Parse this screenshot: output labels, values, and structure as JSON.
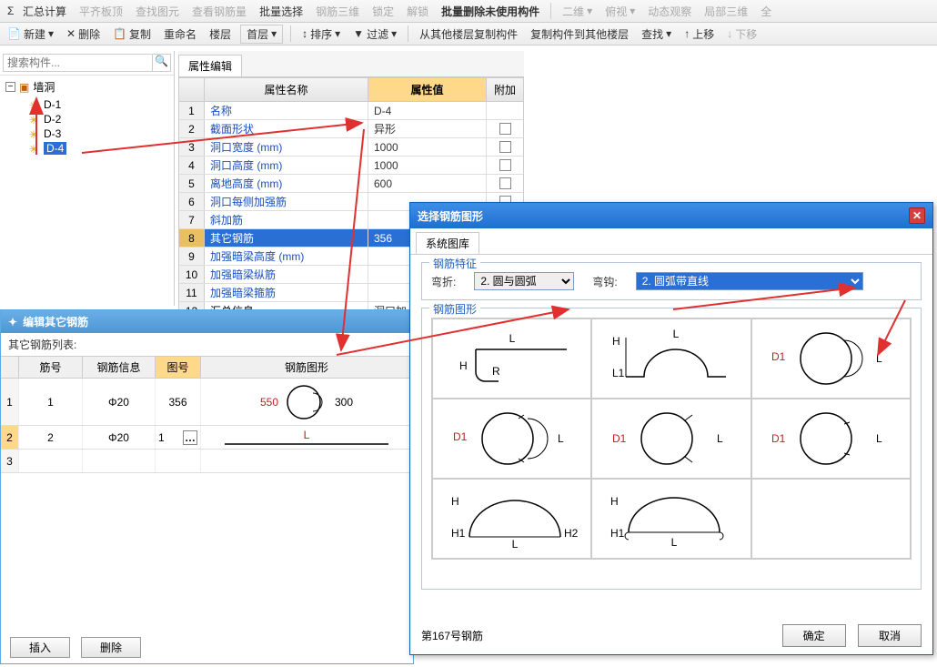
{
  "toolbar1": {
    "sum": "汇总计算",
    "flat": "平齐板顶",
    "find": "查找图元",
    "rebar": "查看钢筋量",
    "batchSel": "批量选择",
    "rebar3d": "钢筋三维",
    "lock": "锁定",
    "unlock": "解锁",
    "batchDel": "批量删除未使用构件",
    "two": "二维",
    "view": "俯视",
    "dyn": "动态观察",
    "part3d": "局部三维",
    "all": "全"
  },
  "toolbar2": {
    "new": "新建",
    "del": "删除",
    "copy": "复制",
    "rename": "重命名",
    "floor": "楼层",
    "first": "首层",
    "sort": "排序",
    "filter": "过滤",
    "copyFrom": "从其他楼层复制构件",
    "copyTo": "复制构件到其他楼层",
    "find": "查找",
    "up": "上移",
    "down": "下移"
  },
  "search": {
    "placeholder": "搜索构件..."
  },
  "tree": {
    "root": "墙洞",
    "items": [
      "D-1",
      "D-2",
      "D-3",
      "D-4"
    ]
  },
  "prop": {
    "tab": "属性编辑",
    "head": {
      "name": "属性名称",
      "value": "属性值",
      "extra": "附加"
    },
    "rows": [
      {
        "n": "1",
        "name": "名称",
        "val": "D-4",
        "link": true,
        "ck": false
      },
      {
        "n": "2",
        "name": "截面形状",
        "val": "异形",
        "link": true,
        "ck": true
      },
      {
        "n": "3",
        "name": "洞口宽度 (mm)",
        "val": "1000",
        "link": true,
        "ck": true
      },
      {
        "n": "4",
        "name": "洞口高度 (mm)",
        "val": "1000",
        "link": true,
        "ck": true
      },
      {
        "n": "5",
        "name": "离地高度 (mm)",
        "val": "600",
        "link": true,
        "ck": true
      },
      {
        "n": "6",
        "name": "洞口每侧加强筋",
        "val": "",
        "link": true,
        "ck": true
      },
      {
        "n": "7",
        "name": "斜加筋",
        "val": "",
        "link": true,
        "ck": true
      },
      {
        "n": "8",
        "name": "其它钢筋",
        "val": "356",
        "link": true,
        "sel": true
      },
      {
        "n": "9",
        "name": "加强暗梁高度 (mm)",
        "val": "",
        "link": true,
        "ck": true
      },
      {
        "n": "10",
        "name": "加强暗梁纵筋",
        "val": "",
        "link": true,
        "ck": true
      },
      {
        "n": "11",
        "name": "加强暗梁箍筋",
        "val": "",
        "link": true,
        "ck": true
      },
      {
        "n": "12",
        "name": "汇总信息",
        "val": "洞口加",
        "link": false
      }
    ]
  },
  "bottom": {
    "title": "编辑其它钢筋",
    "subtitle": "其它钢筋列表:",
    "head": {
      "a": "筋号",
      "b": "钢筋信息",
      "c": "图号",
      "d": "钢筋图形"
    },
    "rows": [
      {
        "n": "1",
        "a": "1",
        "b": "Φ20",
        "c": "356",
        "d1": "550",
        "d2": "300"
      },
      {
        "n": "2",
        "a": "2",
        "b": "Φ20",
        "c": "1",
        "dL": "L"
      }
    ],
    "insert": "插入",
    "delete": "删除"
  },
  "dialog": {
    "title": "选择钢筋图形",
    "tab": "系统图库",
    "fs1": {
      "legend": "钢筋特征",
      "bendLbl": "弯折:",
      "bendVal": "2. 圆与圆弧",
      "hookLbl": "弯钩:",
      "hookVal": "2. 圆弧带直线"
    },
    "fs2": {
      "legend": "钢筋图形"
    },
    "footer": "第167号钢筋",
    "ok": "确定",
    "cancel": "取消"
  }
}
